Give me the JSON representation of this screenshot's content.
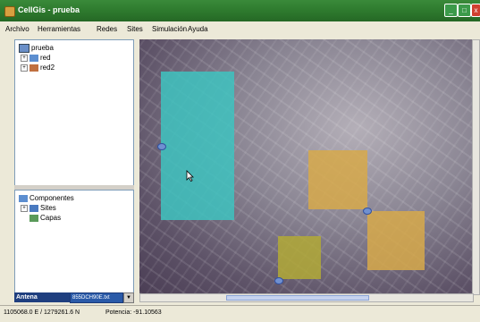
{
  "window": {
    "title": "CellGis - prueba"
  },
  "menu": [
    "Archivo",
    "Herramientas",
    "Redes",
    "Sites",
    "Simulación",
    "Ayuda"
  ],
  "tree_top": {
    "root": "prueba",
    "children": [
      "red",
      "red2"
    ]
  },
  "tree_bottom": {
    "root": "Componentes",
    "children": [
      "Sites",
      "Capas"
    ]
  },
  "layer_bar": {
    "label": "Antena",
    "file": "855DCH90E.txt"
  },
  "status": {
    "coords": "1105068.0 E / 1279261.6 N",
    "power": "Potencia: -91.10563"
  },
  "colors": {
    "cyan_cell": "#3ec3c0",
    "orange_cell": "#d7a94a",
    "olive_cell": "#b2a936"
  }
}
